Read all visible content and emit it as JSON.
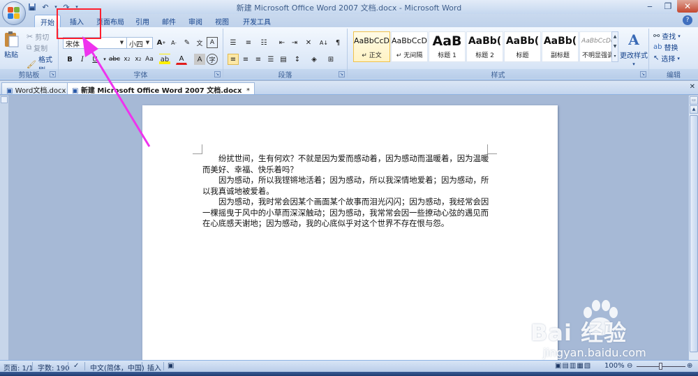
{
  "app": {
    "title": "新建 Microsoft Office Word 2007 文档.docx - Microsoft Word",
    "office_button_icon": "office-logo-icon",
    "qat_items": [
      "save-icon",
      "undo-icon",
      "redo-icon",
      "customize-icon"
    ]
  },
  "tabs": [
    {
      "label": "开始",
      "active": true
    },
    {
      "label": "插入",
      "active": false
    },
    {
      "label": "页面布局",
      "active": false
    },
    {
      "label": "引用",
      "active": false
    },
    {
      "label": "邮件",
      "active": false
    },
    {
      "label": "审阅",
      "active": false
    },
    {
      "label": "视图",
      "active": false
    },
    {
      "label": "开发工具",
      "active": false
    }
  ],
  "ribbon": {
    "clipboard": {
      "group_label": "剪贴板",
      "paste": "粘贴",
      "cut": "剪切",
      "copy": "复制",
      "format_painter": "格式刷"
    },
    "font": {
      "group_label": "字体",
      "font_name": "宋体",
      "font_size": "小四"
    },
    "paragraph": {
      "group_label": "段落"
    },
    "styles": {
      "group_label": "样式",
      "items": [
        {
          "sample": "AaBbCcD",
          "label": "↵ 正文"
        },
        {
          "sample": "AaBbCcD",
          "label": "↵ 无间隔"
        },
        {
          "sample": "AaB",
          "label": "标题 1"
        },
        {
          "sample": "AaBb(",
          "label": "标题 2"
        },
        {
          "sample": "AaBb(",
          "label": "标题"
        },
        {
          "sample": "AaBb(",
          "label": "副标题"
        },
        {
          "sample": "AaBbCcDc",
          "label": "不明显强调"
        }
      ],
      "change_styles": "更改样式"
    },
    "editing": {
      "group_label": "编辑",
      "find": "查找",
      "replace": "替换",
      "select": "选择"
    }
  },
  "doc_tabs": [
    {
      "label": "Word文档.docx",
      "active": false
    },
    {
      "label": "新建 Microsoft Office Word 2007 文档.docx",
      "active": true
    }
  ],
  "document": {
    "paragraphs": [
      "纷扰世间，生有何欢？不就是因为爱而感动着，因为感动而温暖着，因为温暖而美好、幸福、快乐着吗？",
      "因为感动，所以我铿锵地活着；因为感动，所以我深情地爱着；因为感动，所以我真诚地被爱着。",
      "因为感动，我时常会因某个画面某个故事而泪光闪闪；因为感动，我经常会因一棵摇曳于风中的小草而深深触动；因为感动，我常常会因一些撩动心弦的遇见而在心底感天谢地；因为感动，我的心底似乎对这个世界不存在恨与怨。"
    ]
  },
  "statusbar": {
    "page": "页面: 1/1",
    "words": "字数: 190",
    "language": "中文(简体，中国)",
    "mode": "插入",
    "zoom": "100%"
  },
  "watermark": {
    "brand": "Bai  经验",
    "url": "jingyan.baidu.com"
  },
  "colors": {
    "accent": "#15428b",
    "annotation": "#ff1f2d",
    "arrow": "#ee33ee"
  }
}
